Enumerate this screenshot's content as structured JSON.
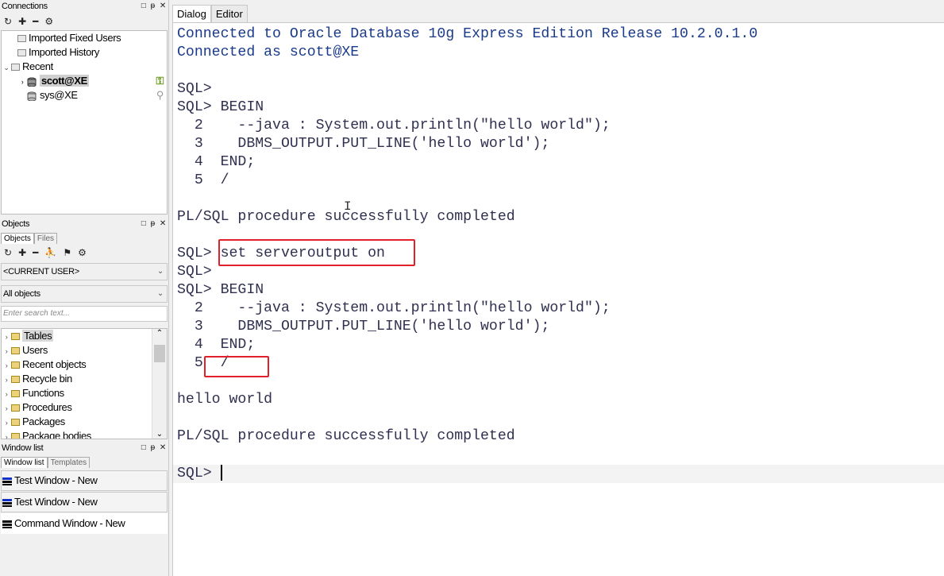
{
  "connections": {
    "title": "Connections",
    "items": [
      {
        "label": "Imported Fixed Users"
      },
      {
        "label": "Imported History"
      },
      {
        "label": "Recent"
      },
      {
        "label": "scott@XE"
      },
      {
        "label": "sys@XE"
      }
    ]
  },
  "objects": {
    "title": "Objects",
    "tabs": [
      "Objects",
      "Files"
    ],
    "user_select": "<CURRENT USER>",
    "filter_select": "All objects",
    "search_placeholder": "Enter search text...",
    "tree": [
      "Tables",
      "Users",
      "Recent objects",
      "Recycle bin",
      "Functions",
      "Procedures",
      "Packages",
      "Package bodies"
    ]
  },
  "window_list": {
    "title": "Window list",
    "tabs": [
      "Window list",
      "Templates"
    ],
    "items": [
      "Test Window - New",
      "Test Window - New",
      "Command Window - New"
    ]
  },
  "editor": {
    "tabs": [
      "Dialog",
      "Editor"
    ],
    "lines": [
      "Connected to Oracle Database 10g Express Edition Release 10.2.0.1.0",
      "Connected as scott@XE",
      "",
      "SQL>",
      "SQL> BEGIN",
      "  2    --java : System.out.println(\"hello world\");",
      "  3    DBMS_OUTPUT.PUT_LINE('hello world');",
      "  4  END;",
      "  5  /",
      "",
      "PL/SQL procedure successfully completed",
      "",
      "SQL> set serveroutput on",
      "SQL>",
      "SQL> BEGIN",
      "  2    --java : System.out.println(\"hello world\");",
      "  3    DBMS_OUTPUT.PUT_LINE('hello world');",
      "  4  END;",
      "  5  /",
      "",
      "hello world",
      "",
      "PL/SQL procedure successfully completed",
      "",
      "SQL> "
    ]
  },
  "colors": {
    "highlight_box": "#e0202a",
    "console_text": "#1a3a8a"
  }
}
